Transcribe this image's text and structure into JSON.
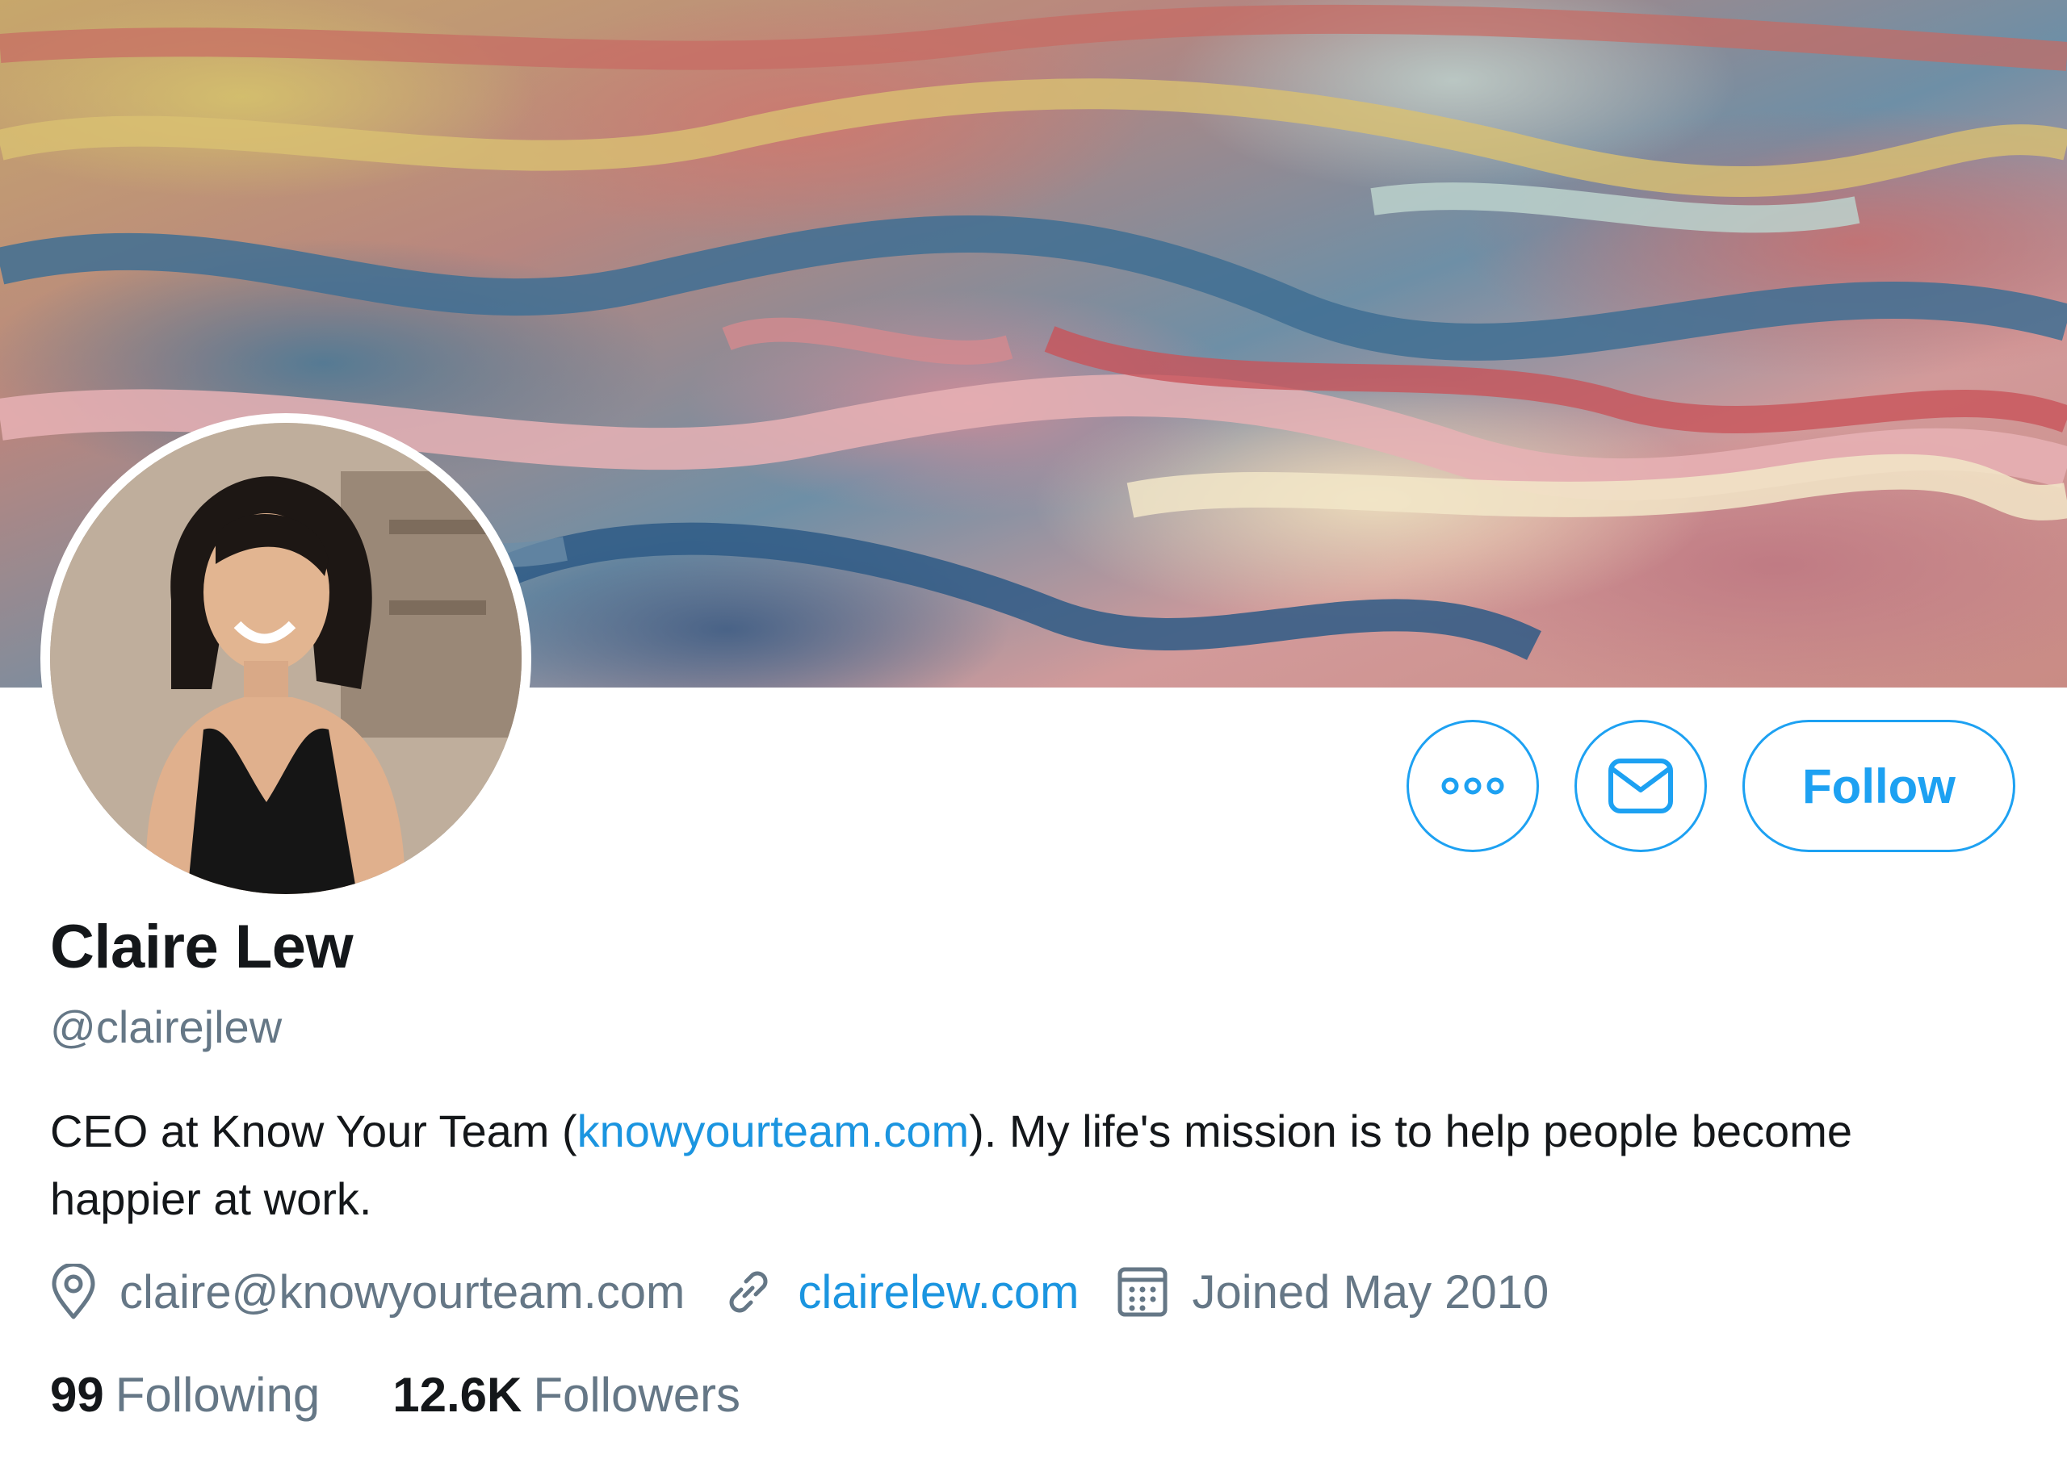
{
  "profile": {
    "display_name": "Claire Lew",
    "handle": "@clairejlew",
    "bio_prefix": "CEO at Know Your Team (",
    "bio_link": "knowyourteam.com",
    "bio_suffix": "). My life's mission is to help people become happier at work.",
    "location": "claire@knowyourteam.com",
    "website": "clairelew.com",
    "joined": "Joined May 2010"
  },
  "stats": {
    "following_count": "99",
    "following_label": "Following",
    "followers_count": "12.6K",
    "followers_label": "Followers"
  },
  "actions": {
    "follow_label": "Follow",
    "more_icon": "more-horizontal-icon",
    "message_icon": "envelope-icon"
  },
  "colors": {
    "accent": "#1da1f2",
    "link": "#1b95e0",
    "muted": "#657786",
    "text": "#14171a"
  }
}
